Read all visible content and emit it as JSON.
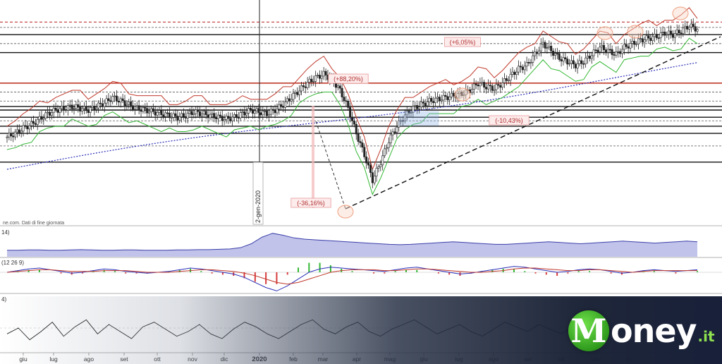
{
  "chart_data": {
    "type": "candlestick",
    "source_note": "ne.com. Dati di fine giornata",
    "x_ticks": [
      "giu",
      "lug",
      "ago",
      "set",
      "ott",
      "nov",
      "dic",
      "2020",
      "feb",
      "mar",
      "apr",
      "mag",
      "giu",
      "lug",
      "ago",
      "set",
      "ott",
      "nov",
      "dic",
      "feb"
    ],
    "highlight_tick": "2020",
    "vertical_marker_label": "2-gen-2020",
    "annotations": [
      {
        "text": "(+6,05%)"
      },
      {
        "text": "(+88,20%)"
      },
      {
        "text": "(-10,43%)"
      },
      {
        "text": "(-36,16%)"
      }
    ],
    "price": {
      "note": "Values are relative index levels (0-100) read from the chart area; no price axis is visible.",
      "closes": [
        40,
        42,
        45,
        47,
        50,
        53,
        55,
        56,
        57,
        56,
        55,
        57,
        59,
        62,
        60,
        58,
        56,
        55,
        54,
        53,
        52,
        51,
        52,
        54,
        53,
        52,
        51,
        50,
        51,
        53,
        55,
        54,
        53,
        55,
        58,
        62,
        66,
        70,
        73,
        75,
        72,
        66,
        56,
        42,
        30,
        16,
        26,
        38,
        46,
        52,
        56,
        58,
        60,
        61,
        62,
        63,
        64,
        66,
        70,
        68,
        67,
        70,
        74,
        78,
        80,
        86,
        92,
        88,
        84,
        82,
        80,
        82,
        86,
        90,
        88,
        86,
        90,
        92,
        94,
        95,
        96,
        98,
        97,
        99,
        102,
        100
      ],
      "horizontal_levels_solid": [
        97,
        87,
        70,
        57,
        55,
        51,
        46,
        42,
        26
      ],
      "horizontal_levels_dashed": [
        101,
        92,
        65,
        60,
        49,
        35
      ],
      "red_dashed_top_level": 104
    },
    "indicator_1": {
      "label": "14)",
      "values": [
        20,
        20,
        21,
        21,
        20,
        20,
        21,
        22,
        21,
        20,
        20,
        21,
        21,
        20,
        20,
        20,
        21,
        21,
        22,
        22,
        23,
        24,
        28,
        40,
        60,
        72,
        66,
        58,
        54,
        52,
        50,
        48,
        46,
        44,
        42,
        40,
        38,
        37,
        38,
        40,
        42,
        44,
        46,
        44,
        42,
        40,
        38,
        38,
        40,
        42,
        44,
        46,
        44,
        42,
        40,
        42,
        44,
        46,
        48,
        46,
        44,
        42,
        44,
        46,
        48,
        46
      ]
    },
    "indicator_2": {
      "label": "(12 26 9)",
      "macd": [
        0,
        2,
        4,
        5,
        3,
        1,
        -1,
        0,
        2,
        4,
        3,
        1,
        0,
        -1,
        0,
        1,
        3,
        5,
        4,
        2,
        0,
        -2,
        -6,
        -12,
        -18,
        -22,
        -16,
        -8,
        0,
        4,
        6,
        5,
        4,
        3,
        2,
        1,
        3,
        5,
        6,
        4,
        2,
        0,
        -2,
        -1,
        1,
        3,
        5,
        7,
        6,
        4,
        2,
        0,
        1,
        3,
        4,
        3,
        1,
        -1,
        0,
        2,
        3,
        2,
        1,
        2,
        3
      ],
      "signal": [
        0,
        1,
        2,
        3,
        3,
        2,
        1,
        1,
        1,
        2,
        2,
        2,
        1,
        0,
        0,
        0,
        1,
        2,
        3,
        3,
        2,
        1,
        -1,
        -4,
        -8,
        -12,
        -14,
        -12,
        -8,
        -4,
        0,
        2,
        3,
        3,
        3,
        2,
        2,
        3,
        4,
        4,
        3,
        2,
        1,
        0,
        0,
        1,
        2,
        4,
        5,
        5,
        4,
        3,
        2,
        2,
        3,
        3,
        2,
        1,
        0,
        1,
        2,
        2,
        2,
        2,
        2
      ]
    },
    "indicator_3": {
      "label": "4)",
      "values": [
        50,
        55,
        45,
        52,
        60,
        48,
        56,
        62,
        50,
        58,
        52,
        46,
        56,
        60,
        54,
        48,
        52,
        58,
        50,
        46,
        54,
        60,
        56,
        50,
        46,
        52,
        58,
        62,
        54,
        50,
        56,
        60,
        52,
        48,
        54,
        58,
        62,
        56,
        50,
        54,
        58,
        52,
        48,
        54,
        60,
        56,
        52,
        58,
        54,
        50,
        56,
        62,
        58,
        54,
        50,
        56,
        60,
        54,
        48,
        52,
        58,
        54
      ]
    }
  },
  "colors": {
    "candle": "#222222",
    "dashed_levels": "#333333",
    "red_level": "#c0392b",
    "red_dashed": "#b71c1c",
    "ma_blue": "#2a2fb8",
    "stop_red": "#c0392b",
    "stop_green": "#33b833",
    "volatility_fill": "#b6b9e6",
    "volatility_line": "#3a3fa8",
    "macd_line": "#2a2fb8",
    "signal_line": "#c0392b",
    "hist_pos": "#33b833",
    "hist_neg": "#d83b3b",
    "label_box_fill": "#fdecec",
    "label_box_stroke": "#e79a9a",
    "highlight_circle": "#f0a080",
    "highlight_fill": "#f8d6c8",
    "blue_box": "#8fb3e6"
  },
  "branding": {
    "logo_initial": "M",
    "logo_rest": "oney",
    "logo_suffix": ".it"
  }
}
